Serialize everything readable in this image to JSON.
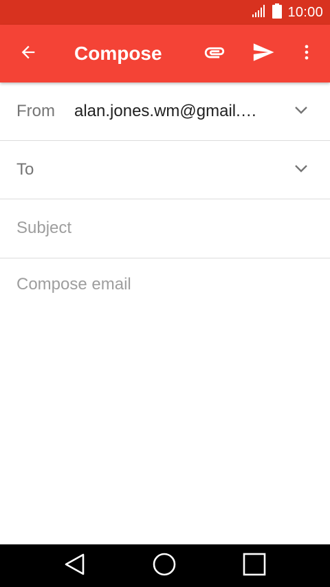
{
  "status_bar": {
    "time": "10:00",
    "icons": [
      "signal-icon",
      "battery-icon"
    ],
    "background": "#d8321f"
  },
  "app_bar": {
    "title": "Compose",
    "background": "#f44336",
    "icons": [
      "arrow-back-icon",
      "paperclip-icon",
      "send-icon",
      "more-vert-icon"
    ]
  },
  "form": {
    "from_label": "From",
    "from_value": "alan.jones.wm@gmail.c…",
    "to_label": "To",
    "to_value": "",
    "subject_placeholder": "Subject",
    "subject_value": "",
    "body_placeholder": "Compose email",
    "body_value": ""
  },
  "nav_bar": {
    "icons": [
      "nav-back-icon",
      "nav-home-icon",
      "nav-recents-icon"
    ]
  }
}
